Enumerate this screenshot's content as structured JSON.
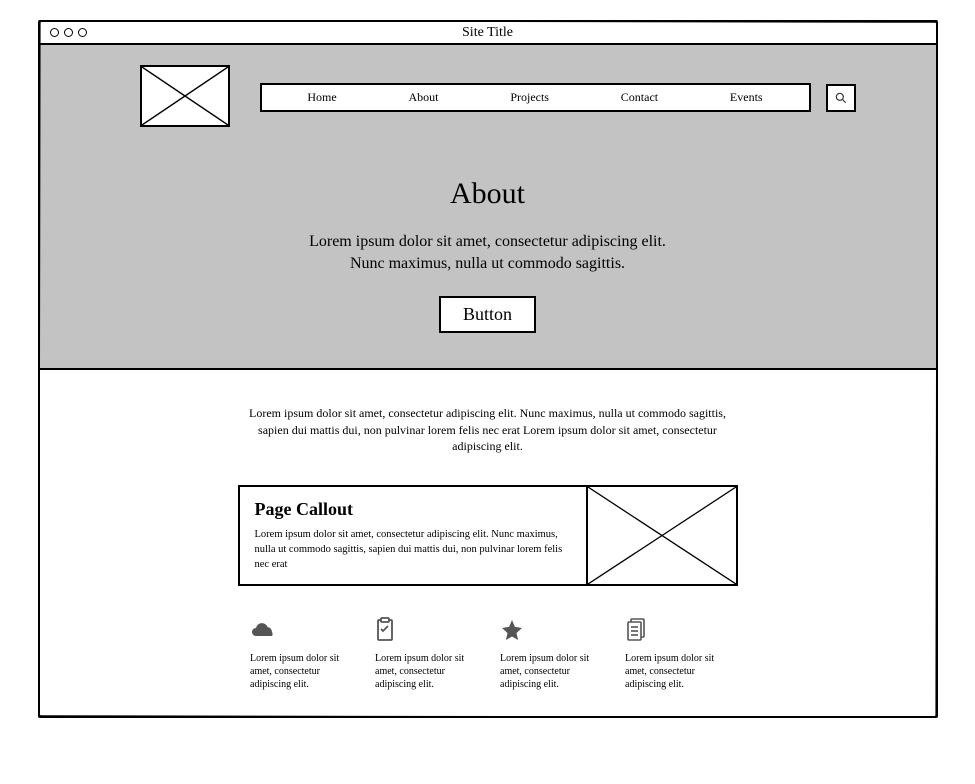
{
  "window": {
    "site_title": "Site Title"
  },
  "nav": {
    "items": [
      "Home",
      "About",
      "Projects",
      "Contact",
      "Events"
    ]
  },
  "hero": {
    "heading": "About",
    "subtext": "Lorem ipsum dolor sit amet, consectetur adipiscing elit.\nNunc maximus, nulla ut commodo sagittis.",
    "button_label": "Button"
  },
  "content": {
    "intro": "Lorem ipsum dolor sit amet, consectetur adipiscing elit. Nunc maximus, nulla ut commodo sagittis, sapien dui mattis dui, non pulvinar lorem felis nec erat Lorem ipsum dolor sit amet, consectetur adipiscing elit.",
    "callout": {
      "title": "Page Callout",
      "body": "Lorem ipsum dolor sit amet, consectetur adipiscing elit. Nunc maximus, nulla ut commodo sagittis, sapien dui mattis dui, non pulvinar lorem felis nec erat"
    },
    "features": [
      {
        "icon": "cloud",
        "text": "Lorem ipsum dolor sit amet, consectetur adipiscing elit."
      },
      {
        "icon": "clipboard",
        "text": "Lorem ipsum dolor sit amet, consectetur adipiscing elit."
      },
      {
        "icon": "star",
        "text": "Lorem ipsum dolor sit amet, consectetur adipiscing elit."
      },
      {
        "icon": "documents",
        "text": "Lorem ipsum dolor sit amet, consectetur adipiscing elit."
      }
    ]
  }
}
